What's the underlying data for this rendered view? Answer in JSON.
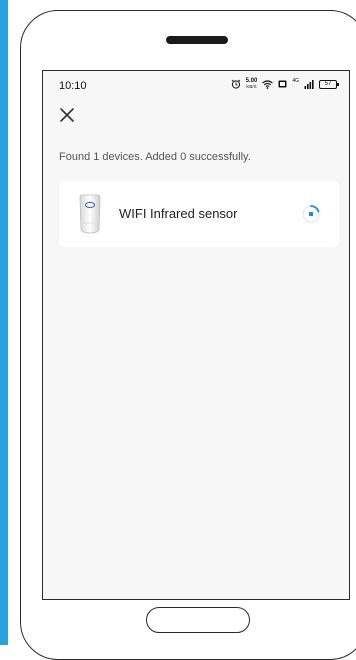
{
  "status_bar": {
    "time": "10:10",
    "speed_value": "5.00",
    "speed_unit": "KB/S",
    "network_label": "4G",
    "battery": "57"
  },
  "header": {
    "close_icon": "close-icon"
  },
  "scan_result": {
    "message": "Found 1 devices. Added 0 successfully."
  },
  "devices": [
    {
      "name": "WIFI Infrared sensor",
      "icon": "infrared-sensor-icon",
      "status_icon": "loading-spinner-icon"
    }
  ],
  "colors": {
    "accent_strip": "#29a3de",
    "spinner": "#1e88e5",
    "screen_bg": "#f7f7f7",
    "card_bg": "#ffffff"
  }
}
